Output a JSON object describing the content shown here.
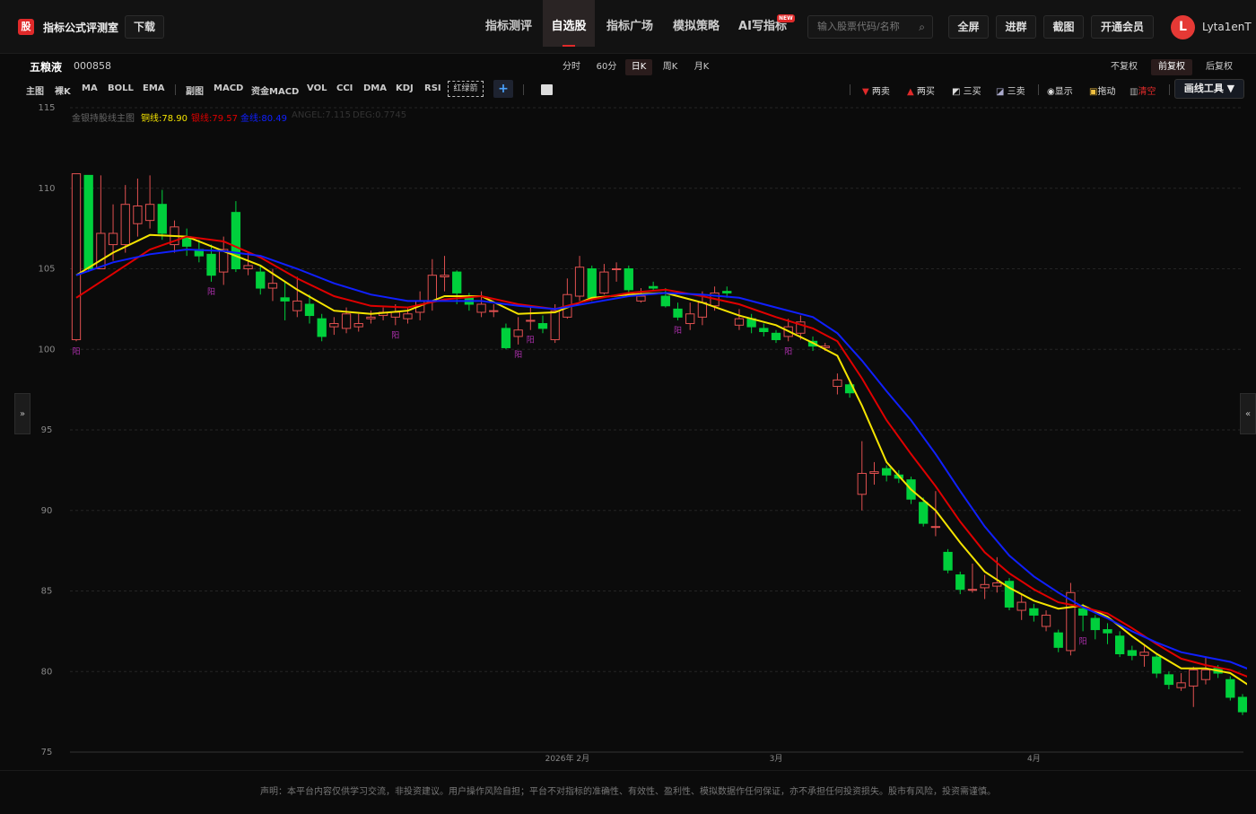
{
  "header": {
    "logo_char": "股",
    "app_name": "指标公式评测室",
    "download": "下载",
    "nav": [
      "指标测评",
      "自选股",
      "指标广场",
      "模拟策略",
      "AI写指标"
    ],
    "active_nav": 1,
    "new_badge": "NEW",
    "search_placeholder": "输入股票代码/名称",
    "buttons": [
      "全屏",
      "进群",
      "截图",
      "开通会员"
    ],
    "avatar_letter": "L",
    "username": "Lyta1enT"
  },
  "stock": {
    "name": "五粮液",
    "code": "000858"
  },
  "periods": [
    "分时",
    "60分",
    "日K",
    "周K",
    "月K"
  ],
  "active_period": 2,
  "adjust": [
    "不复权",
    "前复权",
    "后复权"
  ],
  "active_adjust": 1,
  "indicators": [
    "主图",
    "裸K",
    "MA",
    "BOLL",
    "EMA",
    "副图",
    "MACD",
    "资金MACD",
    "VOL",
    "CCI",
    "DMA",
    "KDJ",
    "RSI"
  ],
  "signal_box": "红绿箭",
  "plus": "+",
  "tools": [
    "两卖",
    "两买",
    "三买",
    "三卖",
    "显示",
    "拖动",
    "清空"
  ],
  "draw_tool": "画线工具 ▼",
  "legend": {
    "title": "金银持股线主图",
    "items": [
      {
        "label": "铜线:78.90",
        "color": "#f5e400"
      },
      {
        "label": "银线:79.57",
        "color": "#e00000"
      },
      {
        "label": "金线:80.49",
        "color": "#1020ff"
      },
      {
        "label": "ANGEL:7.115",
        "color": "#555555"
      },
      {
        "label": "DEG:0.7745",
        "color": "#555555"
      }
    ]
  },
  "side": {
    "left": "»",
    "right": "«"
  },
  "footer": "声明：本平台内容仅供学习交流，非投资建议。用户操作风险自担；平台不对指标的准确性、有效性、盈利性、模拟数据作任何保证，亦不承担任何投资损失。股市有风险，投资需谨慎。",
  "chart_data": {
    "type": "candlestick",
    "y_ticks": [
      115,
      110,
      105,
      100,
      95,
      90,
      85,
      80,
      75
    ],
    "ylim": [
      75,
      115
    ],
    "x_labels": [
      {
        "index": 40,
        "text": "2026年 2月"
      },
      {
        "index": 57,
        "text": "3月"
      },
      {
        "index": 78,
        "text": "4月"
      }
    ],
    "signal_label": "阳",
    "signal_color": "#b030b0",
    "up_color": "#e05050",
    "down_color": "#00d03c",
    "candles": [
      {
        "o": 100.6,
        "c": 110.9,
        "h": 110.9,
        "l": 100.5
      },
      {
        "o": 110.8,
        "c": 105.0,
        "h": 110.8,
        "l": 104.8
      },
      {
        "o": 105.0,
        "c": 107.2,
        "h": 110.8,
        "l": 105.0
      },
      {
        "o": 106.5,
        "c": 107.2,
        "h": 109.0,
        "l": 105.5
      },
      {
        "o": 106.5,
        "c": 109.0,
        "h": 110.2,
        "l": 106.0
      },
      {
        "o": 107.8,
        "c": 108.9,
        "h": 110.6,
        "l": 107.0
      },
      {
        "o": 108.0,
        "c": 109.0,
        "h": 110.8,
        "l": 107.5
      },
      {
        "o": 109.0,
        "c": 107.2,
        "h": 109.9,
        "l": 106.8
      },
      {
        "o": 106.5,
        "c": 107.6,
        "h": 108.0,
        "l": 106.0
      },
      {
        "o": 107.0,
        "c": 106.4,
        "h": 107.5,
        "l": 105.8
      },
      {
        "o": 106.2,
        "c": 105.8,
        "h": 106.8,
        "l": 105.4
      },
      {
        "o": 105.9,
        "c": 104.6,
        "h": 106.5,
        "l": 104.2
      },
      {
        "o": 104.8,
        "c": 106.2,
        "h": 107.0,
        "l": 104.0
      },
      {
        "o": 108.5,
        "c": 105.0,
        "h": 109.2,
        "l": 104.8
      },
      {
        "o": 105.0,
        "c": 105.2,
        "h": 106.0,
        "l": 104.6
      },
      {
        "o": 104.8,
        "c": 103.8,
        "h": 105.2,
        "l": 103.4
      },
      {
        "o": 103.8,
        "c": 104.1,
        "h": 105.0,
        "l": 103.0
      },
      {
        "o": 103.2,
        "c": 103.0,
        "h": 104.2,
        "l": 101.8
      },
      {
        "o": 102.4,
        "c": 103.0,
        "h": 104.5,
        "l": 102.0
      },
      {
        "o": 102.8,
        "c": 102.1,
        "h": 103.4,
        "l": 101.6
      },
      {
        "o": 101.9,
        "c": 100.8,
        "h": 102.2,
        "l": 100.5
      },
      {
        "o": 101.4,
        "c": 101.6,
        "h": 102.0,
        "l": 100.9
      },
      {
        "o": 101.3,
        "c": 102.2,
        "h": 102.6,
        "l": 101.0
      },
      {
        "o": 101.4,
        "c": 101.6,
        "h": 102.2,
        "l": 101.1
      },
      {
        "o": 101.9,
        "c": 102.0,
        "h": 102.4,
        "l": 101.6
      },
      {
        "o": 102.1,
        "c": 102.3,
        "h": 102.6,
        "l": 101.8
      },
      {
        "o": 102.0,
        "c": 102.3,
        "h": 102.8,
        "l": 101.5
      },
      {
        "o": 101.9,
        "c": 102.2,
        "h": 102.6,
        "l": 101.6
      },
      {
        "o": 102.3,
        "c": 103.0,
        "h": 103.6,
        "l": 101.8
      },
      {
        "o": 103.0,
        "c": 104.6,
        "h": 105.6,
        "l": 102.4
      },
      {
        "o": 104.5,
        "c": 104.6,
        "h": 105.8,
        "l": 103.6
      },
      {
        "o": 104.8,
        "c": 103.5,
        "h": 104.9,
        "l": 102.8
      },
      {
        "o": 103.2,
        "c": 102.8,
        "h": 103.5,
        "l": 102.4
      },
      {
        "o": 102.3,
        "c": 102.8,
        "h": 103.6,
        "l": 102.0
      },
      {
        "o": 102.4,
        "c": 102.4,
        "h": 102.8,
        "l": 102.0
      },
      {
        "o": 101.3,
        "c": 100.1,
        "h": 101.6,
        "l": 100.0
      },
      {
        "o": 100.8,
        "c": 101.2,
        "h": 102.0,
        "l": 100.3
      },
      {
        "o": 101.8,
        "c": 101.8,
        "h": 102.6,
        "l": 101.2
      },
      {
        "o": 101.6,
        "c": 101.3,
        "h": 102.1,
        "l": 101.0
      },
      {
        "o": 100.6,
        "c": 102.4,
        "h": 102.8,
        "l": 100.4
      },
      {
        "o": 102.0,
        "c": 103.4,
        "h": 104.4,
        "l": 101.9
      },
      {
        "o": 103.3,
        "c": 105.1,
        "h": 105.8,
        "l": 103.0
      },
      {
        "o": 105.0,
        "c": 103.2,
        "h": 105.2,
        "l": 103.0
      },
      {
        "o": 103.5,
        "c": 104.8,
        "h": 105.3,
        "l": 103.4
      },
      {
        "o": 105.0,
        "c": 105.0,
        "h": 105.4,
        "l": 104.2
      },
      {
        "o": 105.0,
        "c": 103.7,
        "h": 105.2,
        "l": 103.4
      },
      {
        "o": 103.0,
        "c": 103.3,
        "h": 103.8,
        "l": 102.9
      },
      {
        "o": 103.9,
        "c": 103.8,
        "h": 104.2,
        "l": 103.6
      },
      {
        "o": 103.3,
        "c": 102.7,
        "h": 103.8,
        "l": 102.6
      },
      {
        "o": 102.5,
        "c": 102.0,
        "h": 102.9,
        "l": 101.8
      },
      {
        "o": 101.6,
        "c": 102.2,
        "h": 102.9,
        "l": 101.2
      },
      {
        "o": 102.0,
        "c": 102.9,
        "h": 103.6,
        "l": 101.5
      },
      {
        "o": 102.7,
        "c": 103.5,
        "h": 103.9,
        "l": 102.4
      },
      {
        "o": 103.6,
        "c": 103.5,
        "h": 103.9,
        "l": 103.2
      },
      {
        "o": 101.5,
        "c": 101.9,
        "h": 102.5,
        "l": 101.2
      },
      {
        "o": 101.9,
        "c": 101.4,
        "h": 102.2,
        "l": 101.0
      },
      {
        "o": 101.3,
        "c": 101.1,
        "h": 101.6,
        "l": 100.8
      },
      {
        "o": 101.0,
        "c": 100.6,
        "h": 101.2,
        "l": 100.4
      },
      {
        "o": 100.8,
        "c": 101.4,
        "h": 101.9,
        "l": 100.5
      },
      {
        "o": 101.0,
        "c": 101.7,
        "h": 102.1,
        "l": 100.6
      },
      {
        "o": 100.5,
        "c": 100.2,
        "h": 100.8,
        "l": 99.9
      },
      {
        "o": 100.1,
        "c": 100.2,
        "h": 100.4,
        "l": 99.9
      },
      {
        "o": 97.7,
        "c": 98.1,
        "h": 98.5,
        "l": 97.2
      },
      {
        "o": 97.8,
        "c": 97.3,
        "h": 98.0,
        "l": 97.0
      },
      {
        "o": 91.0,
        "c": 92.3,
        "h": 94.3,
        "l": 90.0
      },
      {
        "o": 92.3,
        "c": 92.4,
        "h": 93.0,
        "l": 91.6
      },
      {
        "o": 92.6,
        "c": 92.2,
        "h": 92.8,
        "l": 91.8
      },
      {
        "o": 92.2,
        "c": 92.0,
        "h": 92.5,
        "l": 91.7
      },
      {
        "o": 91.9,
        "c": 90.7,
        "h": 92.1,
        "l": 90.4
      },
      {
        "o": 90.5,
        "c": 89.2,
        "h": 90.8,
        "l": 89.0
      },
      {
        "o": 89.0,
        "c": 89.0,
        "h": 91.2,
        "l": 88.4
      },
      {
        "o": 87.4,
        "c": 86.3,
        "h": 87.6,
        "l": 86.1
      },
      {
        "o": 86.0,
        "c": 85.1,
        "h": 86.2,
        "l": 84.8
      },
      {
        "o": 85.1,
        "c": 85.1,
        "h": 86.7,
        "l": 84.9
      },
      {
        "o": 85.2,
        "c": 85.4,
        "h": 86.0,
        "l": 84.5
      },
      {
        "o": 85.3,
        "c": 85.5,
        "h": 87.1,
        "l": 84.9
      },
      {
        "o": 85.6,
        "c": 84.0,
        "h": 85.8,
        "l": 83.8
      },
      {
        "o": 83.8,
        "c": 84.3,
        "h": 84.8,
        "l": 83.2
      },
      {
        "o": 83.9,
        "c": 83.5,
        "h": 84.2,
        "l": 83.1
      },
      {
        "o": 82.8,
        "c": 83.5,
        "h": 83.8,
        "l": 82.5
      },
      {
        "o": 82.4,
        "c": 81.5,
        "h": 82.6,
        "l": 81.2
      },
      {
        "o": 81.3,
        "c": 84.9,
        "h": 85.5,
        "l": 81.0
      },
      {
        "o": 83.9,
        "c": 83.5,
        "h": 84.2,
        "l": 82.5
      },
      {
        "o": 83.3,
        "c": 82.6,
        "h": 83.5,
        "l": 82.0
      },
      {
        "o": 82.6,
        "c": 82.4,
        "h": 83.0,
        "l": 81.7
      },
      {
        "o": 82.2,
        "c": 81.1,
        "h": 82.5,
        "l": 80.9
      },
      {
        "o": 81.3,
        "c": 81.0,
        "h": 81.6,
        "l": 80.7
      },
      {
        "o": 81.0,
        "c": 81.2,
        "h": 81.6,
        "l": 80.3
      },
      {
        "o": 80.9,
        "c": 79.9,
        "h": 81.1,
        "l": 79.6
      },
      {
        "o": 79.8,
        "c": 79.2,
        "h": 80.0,
        "l": 78.9
      },
      {
        "o": 79.0,
        "c": 79.3,
        "h": 79.9,
        "l": 78.8
      },
      {
        "o": 79.1,
        "c": 80.1,
        "h": 80.3,
        "l": 77.8
      },
      {
        "o": 79.5,
        "c": 80.1,
        "h": 80.9,
        "l": 79.2
      },
      {
        "o": 80.2,
        "c": 79.9,
        "h": 80.4,
        "l": 79.6
      },
      {
        "o": 79.5,
        "c": 78.4,
        "h": 79.7,
        "l": 78.2
      },
      {
        "o": 78.4,
        "c": 77.5,
        "h": 78.6,
        "l": 77.3
      }
    ],
    "series": [
      {
        "name": "铜线",
        "color": "#f5e400",
        "points": [
          [
            0,
            104.6
          ],
          [
            3,
            106.0
          ],
          [
            6,
            107.1
          ],
          [
            9,
            107.0
          ],
          [
            12,
            106.1
          ],
          [
            15,
            105.2
          ],
          [
            18,
            103.7
          ],
          [
            21,
            102.4
          ],
          [
            24,
            102.2
          ],
          [
            27,
            102.4
          ],
          [
            30,
            103.3
          ],
          [
            33,
            103.3
          ],
          [
            36,
            102.2
          ],
          [
            39,
            102.3
          ],
          [
            42,
            103.2
          ],
          [
            45,
            103.4
          ],
          [
            48,
            103.5
          ],
          [
            51,
            102.9
          ],
          [
            54,
            102.1
          ],
          [
            57,
            101.5
          ],
          [
            60,
            100.4
          ],
          [
            62,
            99.6
          ],
          [
            64,
            96.5
          ],
          [
            66,
            93.0
          ],
          [
            68,
            91.3
          ],
          [
            70,
            90.0
          ],
          [
            72,
            88.0
          ],
          [
            74,
            86.2
          ],
          [
            76,
            85.2
          ],
          [
            78,
            84.4
          ],
          [
            80,
            83.9
          ],
          [
            82,
            84.1
          ],
          [
            84,
            83.4
          ],
          [
            86,
            82.2
          ],
          [
            88,
            81.1
          ],
          [
            90,
            80.2
          ],
          [
            92,
            80.2
          ],
          [
            94,
            79.9
          ],
          [
            96,
            78.9
          ]
        ]
      },
      {
        "name": "银线",
        "color": "#e00000",
        "points": [
          [
            0,
            103.2
          ],
          [
            3,
            104.7
          ],
          [
            6,
            106.2
          ],
          [
            9,
            107.0
          ],
          [
            12,
            106.7
          ],
          [
            15,
            105.7
          ],
          [
            18,
            104.4
          ],
          [
            21,
            103.3
          ],
          [
            24,
            102.7
          ],
          [
            27,
            102.6
          ],
          [
            30,
            103.1
          ],
          [
            33,
            103.3
          ],
          [
            36,
            102.8
          ],
          [
            39,
            102.5
          ],
          [
            42,
            103.1
          ],
          [
            45,
            103.5
          ],
          [
            48,
            103.7
          ],
          [
            51,
            103.3
          ],
          [
            54,
            102.8
          ],
          [
            57,
            102.0
          ],
          [
            60,
            101.3
          ],
          [
            62,
            100.5
          ],
          [
            64,
            98.2
          ],
          [
            66,
            95.6
          ],
          [
            68,
            93.5
          ],
          [
            70,
            91.5
          ],
          [
            72,
            89.3
          ],
          [
            74,
            87.4
          ],
          [
            76,
            86.1
          ],
          [
            78,
            85.1
          ],
          [
            80,
            84.3
          ],
          [
            82,
            84.0
          ],
          [
            84,
            83.6
          ],
          [
            86,
            82.7
          ],
          [
            88,
            81.7
          ],
          [
            90,
            80.8
          ],
          [
            92,
            80.4
          ],
          [
            94,
            80.1
          ],
          [
            96,
            79.5
          ]
        ]
      },
      {
        "name": "金线",
        "color": "#1020ff",
        "points": [
          [
            0,
            104.6
          ],
          [
            3,
            105.4
          ],
          [
            6,
            105.9
          ],
          [
            9,
            106.2
          ],
          [
            12,
            106.1
          ],
          [
            15,
            105.8
          ],
          [
            18,
            105.0
          ],
          [
            21,
            104.1
          ],
          [
            24,
            103.4
          ],
          [
            27,
            103.0
          ],
          [
            30,
            103.0
          ],
          [
            33,
            103.0
          ],
          [
            36,
            102.7
          ],
          [
            39,
            102.5
          ],
          [
            42,
            102.9
          ],
          [
            45,
            103.3
          ],
          [
            48,
            103.5
          ],
          [
            51,
            103.4
          ],
          [
            54,
            103.2
          ],
          [
            57,
            102.6
          ],
          [
            60,
            102.0
          ],
          [
            62,
            101.0
          ],
          [
            64,
            99.3
          ],
          [
            66,
            97.4
          ],
          [
            68,
            95.6
          ],
          [
            70,
            93.5
          ],
          [
            72,
            91.2
          ],
          [
            74,
            89.0
          ],
          [
            76,
            87.2
          ],
          [
            78,
            85.9
          ],
          [
            80,
            84.9
          ],
          [
            82,
            84.0
          ],
          [
            84,
            83.3
          ],
          [
            86,
            82.5
          ],
          [
            88,
            81.8
          ],
          [
            90,
            81.2
          ],
          [
            92,
            80.9
          ],
          [
            94,
            80.6
          ],
          [
            96,
            80.0
          ]
        ]
      }
    ],
    "signals": [
      0,
      11,
      26,
      36,
      37,
      49,
      58,
      82
    ]
  }
}
